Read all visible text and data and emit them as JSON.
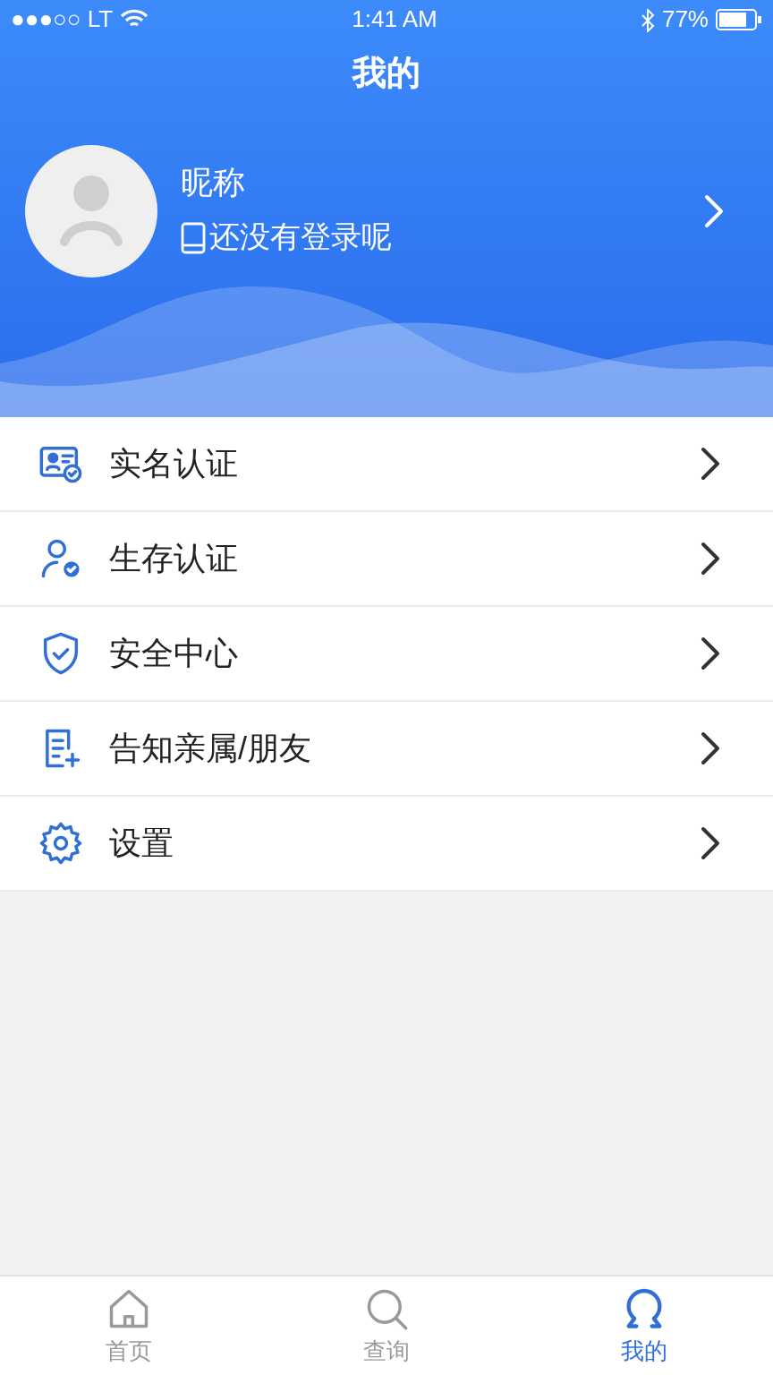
{
  "status_bar": {
    "carrier": "●●●○○ LT",
    "time": "1:41 AM",
    "battery": "77%"
  },
  "title": "我的",
  "profile": {
    "nickname": "昵称",
    "login_hint": "还没有登录呢"
  },
  "menu": [
    {
      "kind": "id-card",
      "label": "实名认证"
    },
    {
      "kind": "person-check",
      "label": "生存认证"
    },
    {
      "kind": "shield",
      "label": "安全中心"
    },
    {
      "kind": "document-plus",
      "label": "告知亲属/朋友"
    },
    {
      "kind": "gear",
      "label": "设置"
    }
  ],
  "tabs": [
    {
      "kind": "home",
      "label": "首页",
      "selected": false
    },
    {
      "kind": "search",
      "label": "查询",
      "selected": false
    },
    {
      "kind": "person",
      "label": "我的",
      "selected": true
    }
  ]
}
